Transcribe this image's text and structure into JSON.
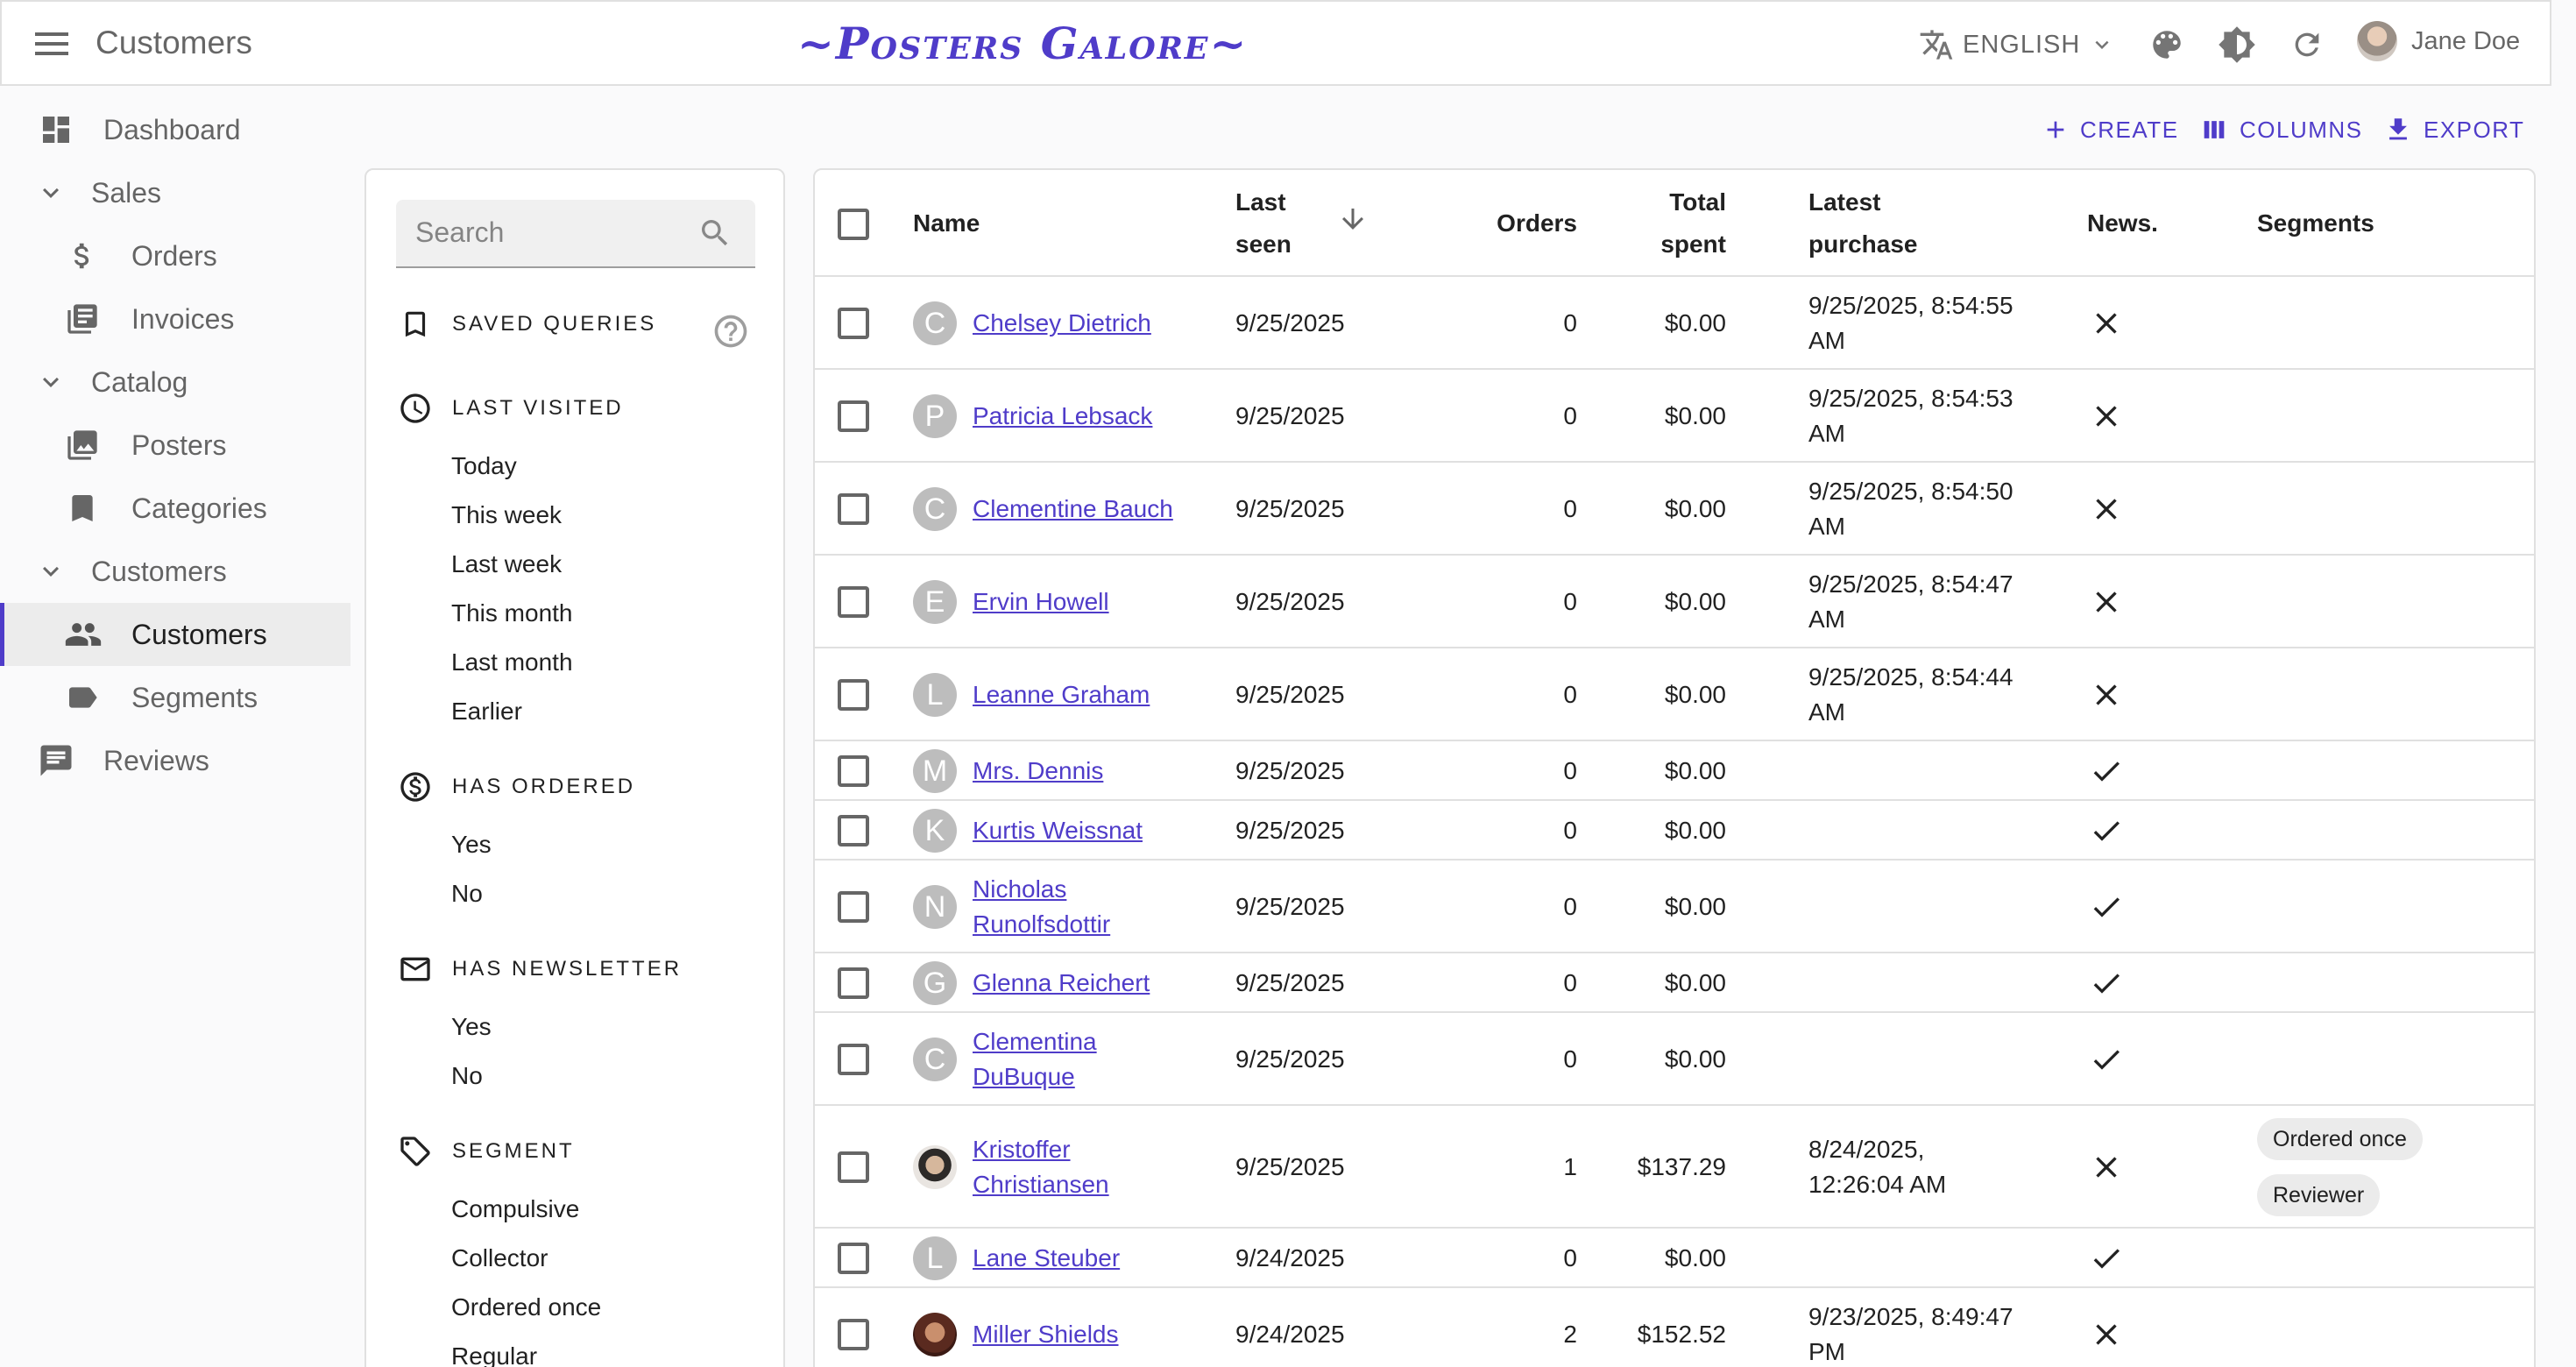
{
  "header": {
    "page_title": "Customers",
    "brand": "~Posters Galore~",
    "language": "ENGLISH",
    "user_name": "Jane Doe"
  },
  "sidebar": {
    "items": [
      {
        "label": "Dashboard",
        "icon": "dashboard-icon"
      },
      {
        "label": "Sales",
        "icon": "chevron-down-icon"
      },
      {
        "label": "Orders",
        "icon": "dollar-icon"
      },
      {
        "label": "Invoices",
        "icon": "invoice-icon"
      },
      {
        "label": "Catalog",
        "icon": "chevron-down-icon"
      },
      {
        "label": "Posters",
        "icon": "image-icon"
      },
      {
        "label": "Categories",
        "icon": "bookmark-icon"
      },
      {
        "label": "Customers",
        "icon": "chevron-down-icon"
      },
      {
        "label": "Customers",
        "icon": "people-icon",
        "active": true
      },
      {
        "label": "Segments",
        "icon": "label-icon"
      },
      {
        "label": "Reviews",
        "icon": "comment-icon"
      }
    ]
  },
  "filters": {
    "search_placeholder": "Search",
    "saved_queries": "SAVED QUERIES",
    "last_visited": {
      "title": "LAST VISITED",
      "options": [
        "Today",
        "This week",
        "Last week",
        "This month",
        "Last month",
        "Earlier"
      ]
    },
    "has_ordered": {
      "title": "HAS ORDERED",
      "options": [
        "Yes",
        "No"
      ]
    },
    "has_newsletter": {
      "title": "HAS NEWSLETTER",
      "options": [
        "Yes",
        "No"
      ]
    },
    "segment": {
      "title": "SEGMENT",
      "options": [
        "Compulsive",
        "Collector",
        "Ordered once",
        "Regular"
      ]
    }
  },
  "actions": {
    "create": "CREATE",
    "columns": "COLUMNS",
    "export": "EXPORT"
  },
  "table": {
    "columns": {
      "name": "Name",
      "last_seen_1": "Last",
      "last_seen_2": "seen",
      "orders": "Orders",
      "total_spent_1": "Total",
      "total_spent_2": "spent",
      "latest_purchase_1": "Latest",
      "latest_purchase_2": "purchase",
      "news": "News.",
      "segments": "Segments"
    },
    "sort": {
      "column": "Last seen",
      "direction": "descending"
    },
    "rows": [
      {
        "initial": "C",
        "name": [
          "Chelsey Dietrich"
        ],
        "last_seen": "9/25/2025",
        "orders": "0",
        "total": "$0.00",
        "latest": [
          "9/25/2025, 8:54:55",
          "AM"
        ],
        "newsletter": false,
        "segments": []
      },
      {
        "initial": "P",
        "name": [
          "Patricia Lebsack"
        ],
        "last_seen": "9/25/2025",
        "orders": "0",
        "total": "$0.00",
        "latest": [
          "9/25/2025, 8:54:53",
          "AM"
        ],
        "newsletter": false,
        "segments": []
      },
      {
        "initial": "C",
        "name": [
          "Clementine Bauch"
        ],
        "last_seen": "9/25/2025",
        "orders": "0",
        "total": "$0.00",
        "latest": [
          "9/25/2025, 8:54:50",
          "AM"
        ],
        "newsletter": false,
        "segments": []
      },
      {
        "initial": "E",
        "name": [
          "Ervin Howell"
        ],
        "last_seen": "9/25/2025",
        "orders": "0",
        "total": "$0.00",
        "latest": [
          "9/25/2025, 8:54:47",
          "AM"
        ],
        "newsletter": false,
        "segments": []
      },
      {
        "initial": "L",
        "name": [
          "Leanne Graham"
        ],
        "last_seen": "9/25/2025",
        "orders": "0",
        "total": "$0.00",
        "latest": [
          "9/25/2025, 8:54:44",
          "AM"
        ],
        "newsletter": false,
        "segments": []
      },
      {
        "initial": "M",
        "name": [
          "Mrs. Dennis"
        ],
        "last_seen": "9/25/2025",
        "orders": "0",
        "total": "$0.00",
        "latest": [],
        "newsletter": true,
        "segments": []
      },
      {
        "initial": "K",
        "name": [
          "Kurtis Weissnat"
        ],
        "last_seen": "9/25/2025",
        "orders": "0",
        "total": "$0.00",
        "latest": [],
        "newsletter": true,
        "segments": []
      },
      {
        "initial": "N",
        "name": [
          "Nicholas",
          "Runolfsdottir"
        ],
        "last_seen": "9/25/2025",
        "orders": "0",
        "total": "$0.00",
        "latest": [],
        "newsletter": true,
        "segments": []
      },
      {
        "initial": "G",
        "name": [
          "Glenna Reichert"
        ],
        "last_seen": "9/25/2025",
        "orders": "0",
        "total": "$0.00",
        "latest": [],
        "newsletter": true,
        "segments": []
      },
      {
        "initial": "C",
        "name": [
          "Clementina",
          "DuBuque"
        ],
        "last_seen": "9/25/2025",
        "orders": "0",
        "total": "$0.00",
        "latest": [],
        "newsletter": true,
        "segments": []
      },
      {
        "initial": "",
        "photo": "photo1",
        "name": [
          "Kristoffer",
          "Christiansen"
        ],
        "last_seen": "9/25/2025",
        "orders": "1",
        "total": "$137.29",
        "latest": [
          "8/24/2025,",
          "12:26:04 AM"
        ],
        "newsletter": false,
        "segments": [
          "Ordered once",
          "Reviewer"
        ]
      },
      {
        "initial": "L",
        "name": [
          "Lane Steuber"
        ],
        "last_seen": "9/24/2025",
        "orders": "0",
        "total": "$0.00",
        "latest": [],
        "newsletter": true,
        "segments": []
      },
      {
        "initial": "",
        "photo": "photo2",
        "name": [
          "Miller Shields"
        ],
        "last_seen": "9/24/2025",
        "orders": "2",
        "total": "$152.52",
        "latest": [
          "9/23/2025, 8:49:47",
          "PM"
        ],
        "newsletter": false,
        "segments": []
      }
    ]
  }
}
